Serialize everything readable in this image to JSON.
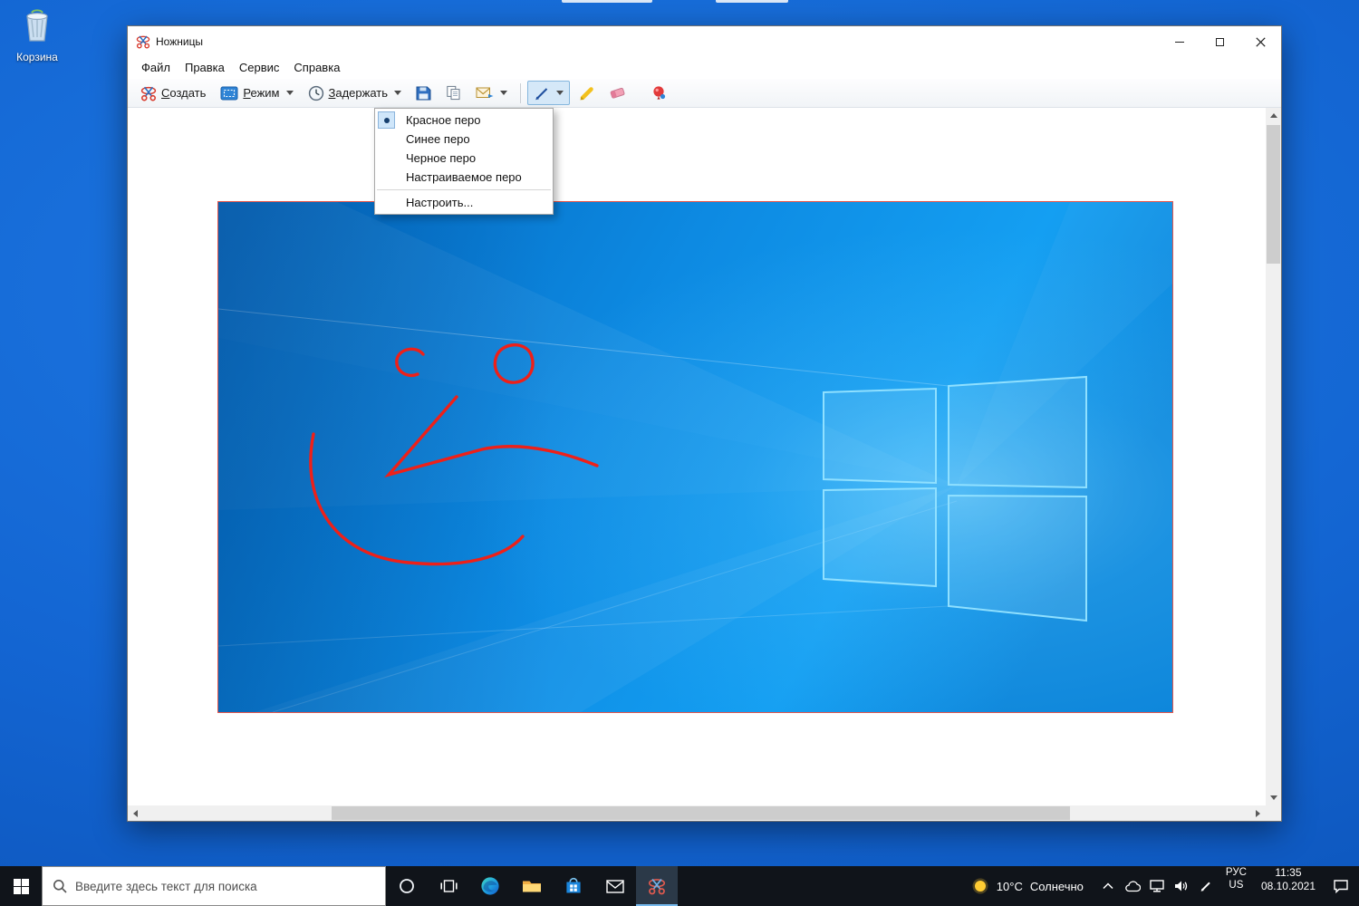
{
  "colors": {
    "desktop_blue": "#1365d2",
    "taskbar_bg": "#10141a",
    "wallpaper_blue": "#0d8ae2",
    "accent_blue": "#0078d7",
    "pen_red": "#ee2019",
    "toolbar_bg": "#f3f5f8",
    "menu_selected_bg": "#cfe6fa"
  },
  "desktop": {
    "recycle_bin_label": "Корзина"
  },
  "window": {
    "title": "Ножницы",
    "menu": [
      "Файл",
      "Правка",
      "Сервис",
      "Справка"
    ],
    "toolbar": {
      "create": "Создать",
      "mode": "Режим",
      "delay": "Задержать"
    },
    "pen_menu": {
      "items": [
        "Красное перо",
        "Синее перо",
        "Черное перо",
        "Настраиваемое перо"
      ],
      "customize": "Настроить...",
      "selected": "Красное перо"
    }
  },
  "taskbar": {
    "search_placeholder": "Введите здесь текст для поиска",
    "weather_temp": "10°C",
    "weather_desc": "Солнечно",
    "language_line1": "РУС",
    "language_line2": "US",
    "time": "11:35",
    "date": "08.10.2021"
  },
  "icons": {
    "app_icon": "scissors-icon",
    "toolbar_icons": [
      "scissors-icon",
      "mode-select-icon",
      "delay-clock-icon",
      "save-icon",
      "copy-icon",
      "email-icon",
      "pen-icon",
      "highlighter-icon",
      "eraser-icon",
      "paint3d-balloon-icon"
    ],
    "taskbar_icons": [
      "start-icon",
      "search-icon",
      "cortana-icon",
      "task-view-icon",
      "edge-icon",
      "file-explorer-icon",
      "store-icon",
      "mail-icon",
      "snipping-tool-icon",
      "sun-icon"
    ],
    "tray_icons": [
      "chevron-up-icon",
      "onedrive-cloud-icon",
      "network-icon",
      "volume-icon",
      "pen-input-icon",
      "action-center-icon"
    ]
  }
}
